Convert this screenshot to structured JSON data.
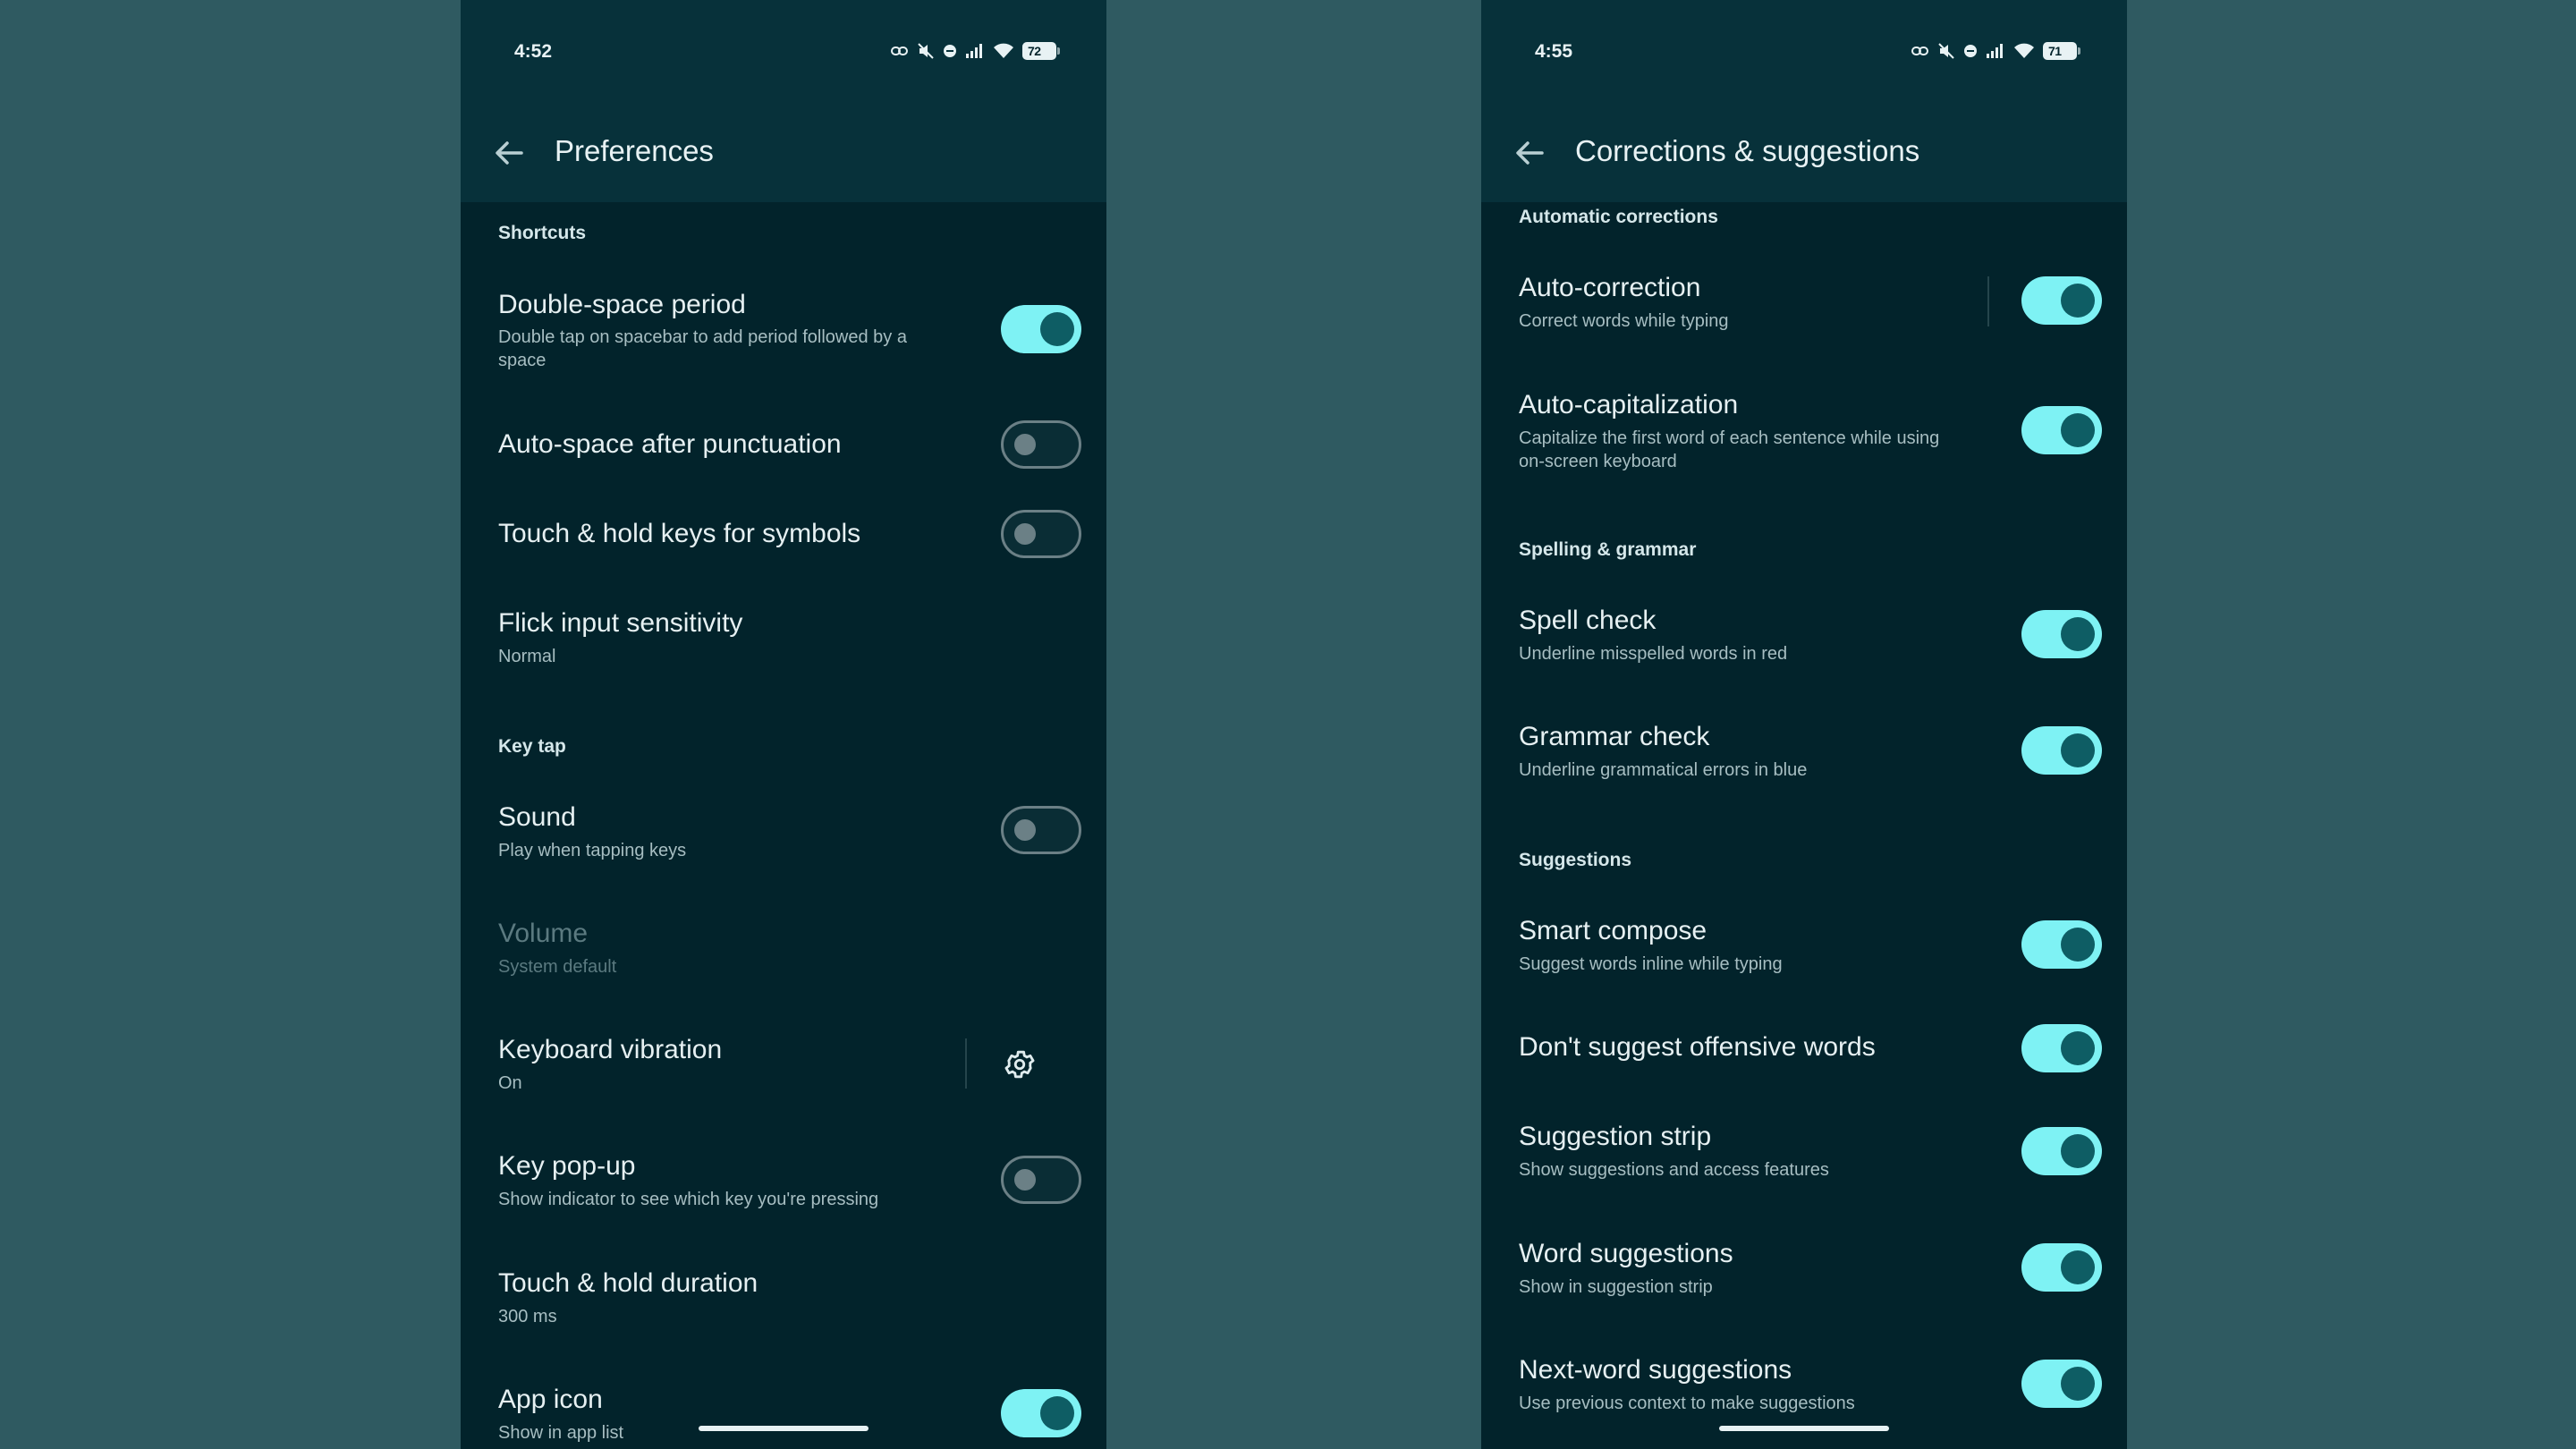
{
  "left": {
    "time": "4:52",
    "battery": "72",
    "title": "Preferences",
    "sections": {
      "shortcuts": "Shortcuts",
      "key_tap": "Key tap"
    },
    "items": {
      "double_space": {
        "title": "Double-space period",
        "subtitle": "Double tap on spacebar to add period followed by a space",
        "state": "on"
      },
      "auto_space": {
        "title": "Auto-space after punctuation",
        "state": "off"
      },
      "touch_hold_symbols": {
        "title": "Touch & hold keys for symbols",
        "state": "off"
      },
      "flick": {
        "title": "Flick input sensitivity",
        "subtitle": "Normal"
      },
      "sound": {
        "title": "Sound",
        "subtitle": "Play when tapping keys",
        "state": "off"
      },
      "volume": {
        "title": "Volume",
        "subtitle": "System default"
      },
      "vibration": {
        "title": "Keyboard vibration",
        "subtitle": "On"
      },
      "key_popup": {
        "title": "Key pop-up",
        "subtitle": "Show indicator to see which key you're pressing",
        "state": "off"
      },
      "hold_duration": {
        "title": "Touch & hold duration",
        "subtitle": "300 ms"
      },
      "app_icon": {
        "title": "App icon",
        "subtitle": "Show in app list",
        "state": "on"
      }
    }
  },
  "right": {
    "time": "4:55",
    "battery": "71",
    "title": "Corrections & suggestions",
    "sections": {
      "automatic": "Automatic corrections",
      "spelling": "Spelling & grammar",
      "suggestions": "Suggestions"
    },
    "items": {
      "auto_correction": {
        "title": "Auto-correction",
        "subtitle": "Correct words while typing",
        "state": "on"
      },
      "auto_cap": {
        "title": "Auto-capitalization",
        "subtitle": "Capitalize the first word of each sentence while using on-screen keyboard",
        "state": "on"
      },
      "spell_check": {
        "title": "Spell check",
        "subtitle": "Underline misspelled words in red",
        "state": "on"
      },
      "grammar_check": {
        "title": "Grammar check",
        "subtitle": "Underline grammatical errors in blue",
        "state": "on"
      },
      "smart_compose": {
        "title": "Smart compose",
        "subtitle": "Suggest words inline while typing",
        "state": "on"
      },
      "offensive": {
        "title": "Don't suggest offensive words",
        "state": "on"
      },
      "suggestion_strip": {
        "title": "Suggestion strip",
        "subtitle": "Show suggestions and access features",
        "state": "on"
      },
      "word_suggestions": {
        "title": "Word suggestions",
        "subtitle": "Show in suggestion strip",
        "state": "on"
      },
      "next_word": {
        "title": "Next-word suggestions",
        "subtitle": "Use previous context to make suggestions",
        "state": "on"
      }
    }
  },
  "colors": {
    "background": "#2f5a61",
    "surface": "#02232b",
    "appbar": "#07313a",
    "toggle_on": "#7ef2f4",
    "toggle_knob_on": "#0e5d64",
    "toggle_off_outline": "#6b8086"
  },
  "icons": [
    "back-arrow-icon",
    "gear-icon",
    "wifi-icon",
    "signal-icon",
    "dnd-icon",
    "mute-icon",
    "link-icon",
    "battery-icon"
  ]
}
